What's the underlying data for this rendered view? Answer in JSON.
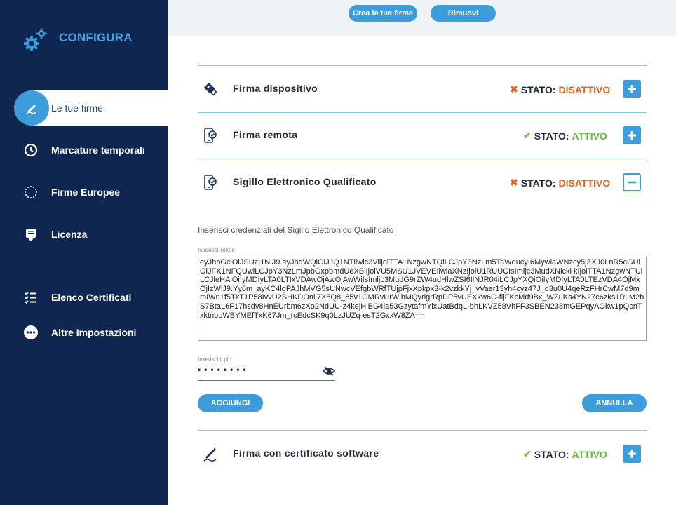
{
  "brand": {
    "title": "CONFIGURA",
    "icon": "gears-icon"
  },
  "sidebar": {
    "items": [
      {
        "label": "Le tue firme",
        "icon": "signature-pen-icon",
        "active": true
      },
      {
        "label": "Marcature temporali",
        "icon": "clock-icon"
      },
      {
        "label": "Firme Europee",
        "icon": "eu-stars-icon"
      },
      {
        "label": "Licenza",
        "icon": "license-icon"
      },
      {
        "label": "Elenco Certificati",
        "icon": "list-check-icon"
      },
      {
        "label": "Altre Impostazioni",
        "icon": "more-dots-icon"
      }
    ]
  },
  "topbar": {
    "create_label": "Crea la tua firma",
    "remove_label": "Rimuovi"
  },
  "status_label": "STATO:",
  "rows": [
    {
      "title": "Firma dispositivo",
      "status": "DISATTIVO",
      "icon": "usb-key-icon",
      "toggle": "expand"
    },
    {
      "title": "Firma remota",
      "status": "ATTIVO",
      "icon": "mobile-sign-icon",
      "toggle": "expand"
    },
    {
      "title": "Sigillo Elettronico Qualificato",
      "status": "DISATTIVO",
      "icon": "mobile-sign-icon",
      "toggle": "collapse"
    },
    {
      "title": "Firma con certificato software",
      "status": "ATTIVO",
      "icon": "software-pen-icon",
      "toggle": "expand"
    }
  ],
  "form": {
    "intro": "Inserisci credenziali del Sigillo Elettronico Qualificato",
    "token_label": "Inserisci Token",
    "token_value": "eyJhbGciOiJSUzI1NiJ9.eyJhdWQiOiJJQ1NTliwic3ViljoiTTA1NzgwNTQiLCJpY3NzLm5TaWducyI6MywiaWNzcy5jZXJ0LnR5cGUiOiJFX1NFQUwiLCJpY3NzLmJpbGxpbmdUeXBlIjoiVU5MSU1JVEVEIiwiaXNzIjoiU1RUUCIsImljc3MudXNlckl kIjoiTTA1NzgwNTUiLCJleHAiOiIyMDIyLTA0LTIxVDAwOjAwOjAwWiIsImljc3MudG9rZW4udHlwZSI6IlNJR04iLCJpYXQiOiIyMDIyLTA0LTEzVDA4OjMxOjIzWiJ9.Yy6m_ayKC4lgPAJhMVG5sUNwcVEfgbWRfTUjpFjxXpkpx3-k2vzkkYj_vVaer13yh4cyz47J_d3u0U4qeRzFHrCwM7d9mmIWn1f5TkT1P58IvvU2SHKDOnil7X8Q8_85v1GMRvUrWlbMQyrigrRpDP5vUEXkw6C-fijFKcMd9Bx_WZuKs4YN27c6zks1RlIM2bS7BtaL6F17hsdv8HnEUrbm6zXo2NdUU-z4kejHlBG4la53GzytafmYixUatBdqL-bhLKVZ58VhFF3SBEN238mGEPqyAOkw1pQcnTxktnbpWBYMEfTxK67Jm_rcEdcSK9q0LzJUZq-esT2GxxW8ZA==",
    "pin_label": "Inserisci il pin",
    "pin_value": "••••••••",
    "add_label": "AGGIUNGI",
    "cancel_label": "ANNULLA"
  },
  "colors": {
    "sidebar": "#0e2650",
    "accent": "#3d9ddb",
    "active": "#66b940",
    "inactive": "#e8621c"
  }
}
